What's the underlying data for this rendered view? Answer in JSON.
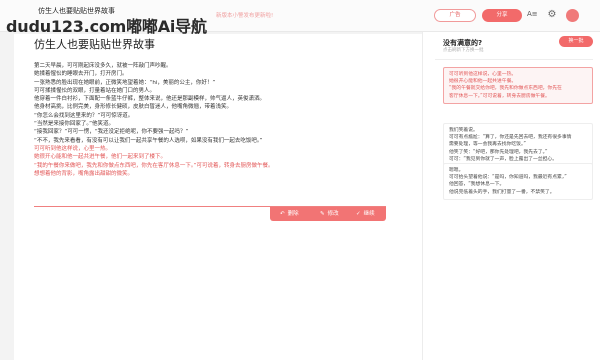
{
  "app": {
    "title": "仿生人也要贴贴世界故事",
    "notice": "新版本小警发布更新啦!",
    "ai_button": "广告",
    "share_button": "分享",
    "font_icon_label": "A≡",
    "watermark": "dudu123.com嘟嘟Ai导航"
  },
  "document": {
    "title": "仿生人也要贴贴世界故事",
    "paragraphs": [
      {
        "text": "第二天早晨，可可刚起床没多久，就被一阵敲门声吵醒。",
        "highlight": false
      },
      {
        "text": "她揉着惺忪的睡眼去开门，打开房门。",
        "highlight": false
      },
      {
        "text": "一张熟悉的脸出现在她眼前，正微笑地望着她：“hi，美丽的公主，你好！”",
        "highlight": false
      },
      {
        "text": "可可揉揉惺忪的双眼，打量着站在她门口的男人。",
        "highlight": false
      },
      {
        "text": "他穿着一件白衬衫，下面配一条蓝牛仔裤，整体来说，他还是那副模样，帅气逼人，英俊潇洒。",
        "highlight": false
      },
      {
        "text": "他身材高挑，比例完美，身形修长健硕，皮肤白皙迷人，他嘴角微翘，带着浅笑。",
        "highlight": false
      },
      {
        "text": "“你怎么会找到这里来的？”可可惊讶道。",
        "highlight": false
      },
      {
        "text": "“当然是来接你回家了。”他笑道。",
        "highlight": false
      },
      {
        "text": "“接我回家？”可可一愣，“我还没定拒绝呢，你不要强一起吗？”",
        "highlight": false
      },
      {
        "text": "“不不，我先来看看，有没有可以让我们一起共享午餐的人选呗，如果没有我们一起去吃饭吧。”",
        "highlight": false
      },
      {
        "text": "可可听到他这样说，心里一热。",
        "highlight": true
      },
      {
        "text": "她很开心能和他一起共进午餐，他们一起来到了楼下。",
        "highlight": true
      },
      {
        "text": "“我的午餐你来做吧，我先和你做点东西吧，你先在客厅休息一下。”可可说着，转身去厨房做午餐。",
        "highlight": true
      },
      {
        "text": "想想着他的背影，嘴角露出甜甜的微笑。",
        "highlight": true
      }
    ],
    "actions": [
      {
        "label": "删除",
        "icon": "↶"
      },
      {
        "label": "修改",
        "icon": "✎"
      },
      {
        "label": "继续",
        "icon": "✓"
      }
    ]
  },
  "panel": {
    "title": "没有满意的?",
    "subtitle": "点击刷新下方换一批",
    "generate_button": "换一批",
    "cards": [
      {
        "active": true,
        "lines": [
          {
            "text": "可可听到他这样说，心里一热。",
            "red": true
          },
          {
            "text": "她很开心能和他一起共进午餐。",
            "red": true
          },
          {
            "text": "“我的午餐就交给你吧，我先和你做点东西吧，你先在",
            "red": true
          },
          {
            "text": "客厅休息一下。”可可说着，转身去厨房做午餐。",
            "red": true
          }
        ]
      },
      {
        "active": false,
        "lines": [
          {
            "text": "我们笑着说。",
            "red": false
          },
          {
            "text": "可可有点尴尬：“算了，你还是先回去吧，我还有很多事情",
            "red": false
          },
          {
            "text": "需要处理，等一会我再去找你吃饭。”",
            "red": false
          },
          {
            "text": "他笑了笑：“好吧，那你先处理吧，我先去了。”",
            "red": false
          },
          {
            "text": "可可：“我见到你就了一声，脸上露出了一丝担心。",
            "red": false
          }
        ]
      },
      {
        "active": false,
        "lines": [
          {
            "text": "嗯嗯。",
            "red": false
          },
          {
            "text": "可可抬头望着他说：“是吗，你知道吗，我最近有点累，”",
            "red": false
          },
          {
            "text": "他回答，“我想休息一下。",
            "red": false
          },
          {
            "text": "他说完低着头的手，我们打量了一番，不禁笑了。",
            "red": false
          }
        ]
      }
    ]
  }
}
